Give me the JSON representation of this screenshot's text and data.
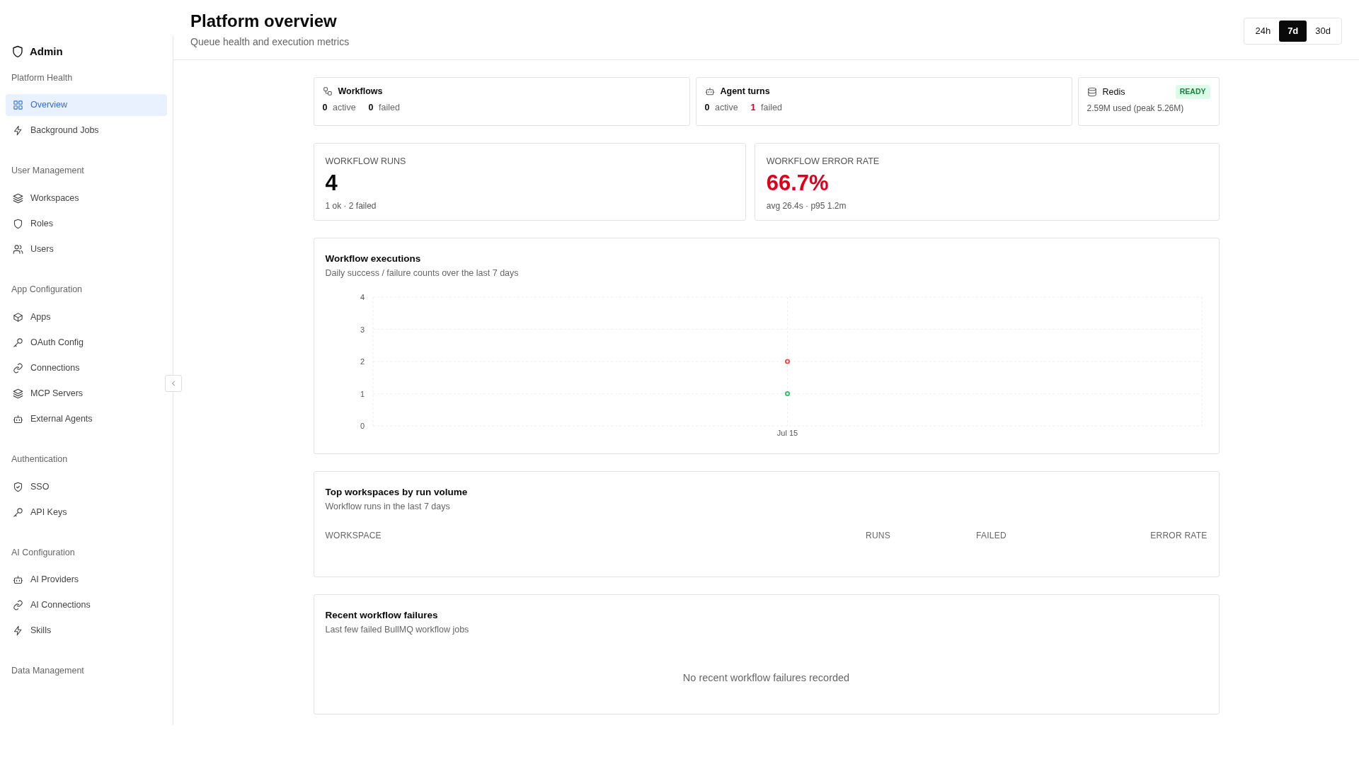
{
  "sidebar": {
    "title": "Admin",
    "sections": [
      {
        "label": "Platform Health",
        "items": [
          {
            "label": "Overview",
            "kind": "grid",
            "selected": true
          },
          {
            "label": "Background Jobs",
            "kind": "bolt",
            "selected": false
          }
        ]
      },
      {
        "label": "User Management",
        "items": [
          {
            "label": "Workspaces",
            "kind": "layers",
            "selected": false
          },
          {
            "label": "Roles",
            "kind": "shield",
            "selected": false
          },
          {
            "label": "Users",
            "kind": "users",
            "selected": false
          }
        ]
      },
      {
        "label": "App Configuration",
        "items": [
          {
            "label": "Apps",
            "kind": "box",
            "selected": false
          },
          {
            "label": "OAuth Config",
            "kind": "key",
            "selected": false
          },
          {
            "label": "Connections",
            "kind": "link",
            "selected": false
          },
          {
            "label": "MCP Servers",
            "kind": "layers",
            "selected": false
          },
          {
            "label": "External Agents",
            "kind": "bot",
            "selected": false
          }
        ]
      },
      {
        "label": "Authentication",
        "items": [
          {
            "label": "SSO",
            "kind": "shieldcheck",
            "selected": false
          },
          {
            "label": "API Keys",
            "kind": "key",
            "selected": false
          }
        ]
      },
      {
        "label": "AI Configuration",
        "items": [
          {
            "label": "AI Providers",
            "kind": "bot",
            "selected": false
          },
          {
            "label": "AI Connections",
            "kind": "link",
            "selected": false
          },
          {
            "label": "Skills",
            "kind": "bolt",
            "selected": false
          }
        ]
      },
      {
        "label": "Data Management"
      }
    ]
  },
  "header": {
    "title": "Platform overview",
    "subtitle": "Queue health and execution metrics",
    "ranges": [
      {
        "label": "24h",
        "selected": false
      },
      {
        "label": "7d",
        "selected": true
      },
      {
        "label": "30d",
        "selected": false
      }
    ]
  },
  "queues": [
    {
      "title": "Workflows",
      "kind": "workflow",
      "stats": [
        {
          "text": "**0** active",
          "alert": false
        },
        {
          "text": "**0** failed",
          "alert": false
        }
      ]
    },
    {
      "title": "Agent turns",
      "kind": "bot",
      "stats": [
        {
          "text": "**0** active",
          "alert": false
        },
        {
          "text": "**1** failed",
          "alert": true
        }
      ]
    }
  ],
  "redis": {
    "title": "Redis",
    "badge": "READY",
    "detail": "2.59M used (peak 5.26M)"
  },
  "metrics": [
    {
      "label": "WORKFLOW RUNS",
      "value": "4",
      "detail": "1 ok · 2 failed",
      "alert": false
    },
    {
      "label": "WORKFLOW ERROR RATE",
      "value": "66.7%",
      "detail": "avg 26.4s · p95 1.2m",
      "alert": true
    }
  ],
  "executions": {
    "title": "Workflow executions",
    "subtitle": "Daily success / failure counts over the last 7 days",
    "chart_data": {
      "type": "line",
      "categories": [
        "Jul 15"
      ],
      "series": [
        {
          "color": "#22c55e",
          "values": [
            1
          ],
          "marker": true
        },
        {
          "color": "#ef4444",
          "values": [
            2
          ],
          "marker": true
        }
      ],
      "ylim": [
        0,
        4
      ],
      "yticks": [
        0,
        1,
        2,
        3,
        4
      ],
      "grid": true
    }
  },
  "top_workspaces": {
    "title": "Top workspaces by run volume",
    "subtitle": "Workflow runs in the last 7 days",
    "columns": [
      "WORKSPACE",
      "RUNS",
      "FAILED",
      "ERROR RATE"
    ]
  },
  "failures": {
    "title": "Recent workflow failures",
    "subtitle": "Last few failed BullMQ workflow jobs",
    "empty": "No recent workflow failures recorded"
  }
}
